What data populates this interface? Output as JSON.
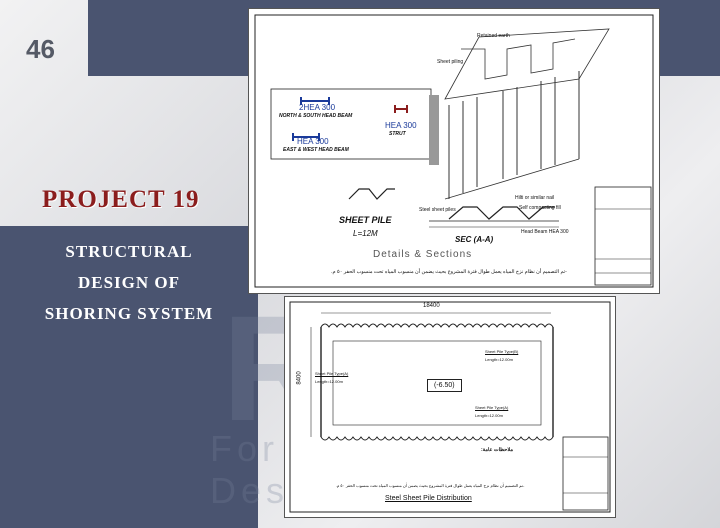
{
  "slide": {
    "number": "46"
  },
  "project": {
    "label": "PROJECT 19"
  },
  "title": {
    "line1": "STRUCTURAL",
    "line2": "DESIGN OF",
    "line3": "SHORING SYSTEM"
  },
  "watermark": {
    "logo": "RNT",
    "tagline": "For Engineering Designs"
  },
  "drawing1": {
    "beam_2hea": "2HEA 300",
    "beam_2hea_sub": "NORTH & SOUTH HEAD BEAM",
    "beam_hea": "HEA 300",
    "beam_hea_sub": "EAST & WEST HEAD BEAM",
    "strut_hea": "HEA 300",
    "strut_sub": "STRUT",
    "retained_earth": "Retained earth",
    "sheet_piling": "Sheet piling",
    "hilti": "Hilti or similar nail",
    "self_compacting": "Self compacting fill",
    "steel_sheet_piles": "Steel sheet piles",
    "head_beam": "Head Beam HEA 300",
    "sheet_pile": "SHEET PILE",
    "sheet_pile_len": "L=12M",
    "section": "SEC (A-A)",
    "caption": "Details & Sections",
    "note_ar": "-تم التصميم أن نظام نزح المياه يعمل طوال فترة المشروع بحيث يضمن أن منسوب المياه تحت منسوب الحفر ٥٠ م."
  },
  "drawing2": {
    "dim_width": "18400",
    "dim_height": "8400",
    "level": "(-6.50)",
    "pile_type_a": "Sheet Pile Type(A)",
    "pile_len_a": "Length=12.00m",
    "pile_type_b": "Sheet Pile Type(B)",
    "pile_len_b": "Length=12.00m",
    "caption": "Steel Sheet Pile Distribution",
    "notes_title": "ملاحظات عامة:",
    "note_ar": "-تم التصميم أن نظام نزح المياه يعمل طوال فترة المشروع بحيث يضمن أن منسوب المياه تحت منسوب الحفر ٥٠ م."
  }
}
